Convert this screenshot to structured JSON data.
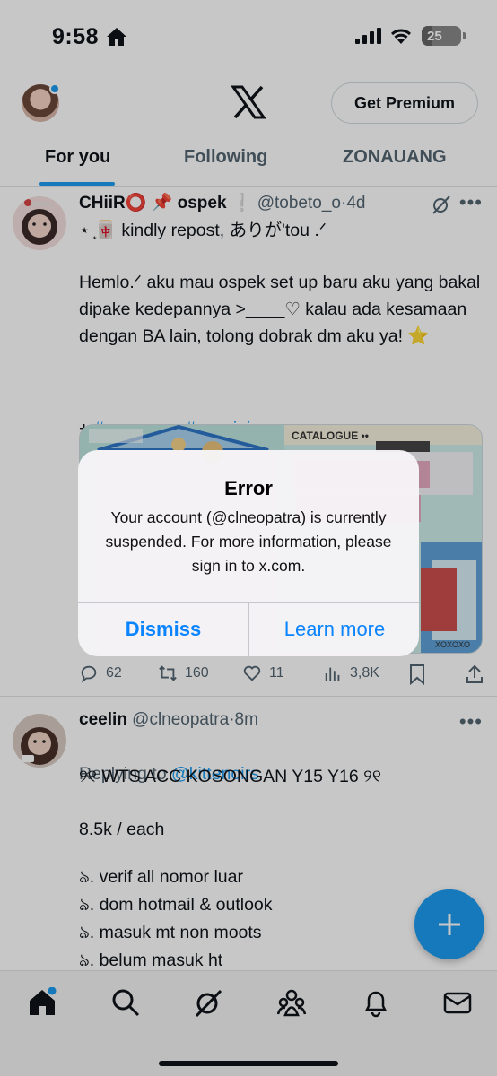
{
  "status_bar": {
    "time": "9:58",
    "battery": "25"
  },
  "header": {
    "premium_button": "Get Premium"
  },
  "tabs": [
    {
      "label": "For you",
      "active": true
    },
    {
      "label": "Following",
      "active": false
    },
    {
      "label": "ZONAUANG",
      "active": false
    }
  ],
  "tweet1": {
    "name": "CHiiR⭕ 📌 ospek ❕",
    "handle": "@tobeto_o",
    "time": "4d",
    "line1": "⋆ ͙🀄 kindly repost, ありが'tou .ᐟ",
    "body": "Hemlo.ᐟ aku mau ospek set up baru aku yang bakal dipake kedepannya >____♡ kalau ada kesamaan dengan BA lain, tolong dobrak dm aku ya! ⭐",
    "hashtags_prefix": "+ ",
    "hashtags": "#zonauang #zonajajan",
    "media_label_1": "CATALOGUE ••",
    "media_label_2": "XOXOXO",
    "replies": "62",
    "retweets": "160",
    "likes": "11",
    "views": "3,8K"
  },
  "tweet2": {
    "name": "ceelin",
    "handle": "@clneopatra",
    "time": "8m",
    "replying_prefix": "Replying to ",
    "replying_handle": "@kittenoirs",
    "line1": "୨୧ WTS ACC KOSONGAN Y15 Y16 ୨୧",
    "line2": "8.5k / each",
    "item1": "ঌ. verif all nomor luar",
    "item2": "ঌ. dom hotmail & outlook",
    "item3": "ঌ. masuk mt non moots",
    "item4": "ঌ. belum masuk ht"
  },
  "alert": {
    "title": "Error",
    "message": "Your account (@clneopatra) is currently suspended. For more information, please sign in to x.com.",
    "dismiss": "Dismiss",
    "learn_more": "Learn more"
  },
  "colors": {
    "accent": "#1d9bf0",
    "ios_blue": "#0a84ff",
    "text_primary": "#0f1419",
    "text_secondary": "#536471"
  },
  "icons": [
    "home-icon",
    "search-icon",
    "grok-icon",
    "communities-icon",
    "notifications-icon",
    "messages-icon",
    "compose-icon"
  ]
}
